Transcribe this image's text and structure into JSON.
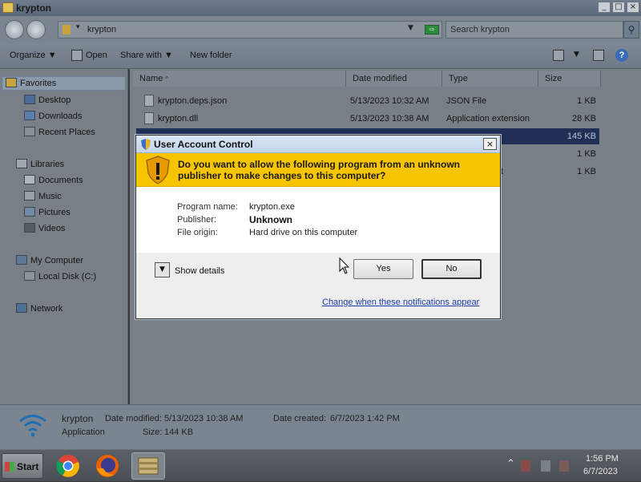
{
  "explorer": {
    "window_title": "krypton",
    "window_buttons": {
      "minimize": "_",
      "maximize": "□",
      "close": "×"
    },
    "address": {
      "path": "krypton",
      "arrow": "▾",
      "dropdown": "▼",
      "go": "⇨"
    },
    "search": {
      "placeholder": "Search krypton",
      "icon": "⚲"
    },
    "toolbar": {
      "organize": "Organize ▼",
      "open": "Open",
      "share_with": "Share with ▼",
      "new_folder": "New folder",
      "views_arrow": "▼",
      "help": "?"
    },
    "nav": {
      "favorites": "Favorites",
      "desktop": "Desktop",
      "downloads": "Downloads",
      "recent_places": "Recent Places",
      "libraries": "Libraries",
      "documents": "Documents",
      "music": "Music",
      "pictures": "Pictures",
      "videos": "Videos",
      "my_computer": "My Computer",
      "local_disk": "Local Disk (C:)",
      "network": "Network"
    },
    "columns": {
      "name": "Name",
      "sort_indicator": "^",
      "date_modified": "Date modified",
      "type": "Type",
      "size": "Size"
    },
    "files": [
      {
        "name": "krypton.deps.json",
        "date": "5/13/2023 10:32 AM",
        "type": "JSON File",
        "size": "1 KB"
      },
      {
        "name": "krypton.dll",
        "date": "5/13/2023 10:38 AM",
        "type": "Application extension",
        "size": "28 KB"
      },
      {
        "name": "",
        "date": "",
        "type": "",
        "size": "145 KB"
      },
      {
        "name": "",
        "date": "",
        "type": "",
        "size": "1 KB"
      },
      {
        "name": "",
        "date": "",
        "type": "t",
        "size": "1 KB"
      }
    ],
    "details": {
      "name": "krypton",
      "type": "Application",
      "date_modified_label": "Date modified:",
      "date_modified": "5/13/2023 10:38 AM",
      "size_label": "Size:",
      "size": "144 KB",
      "date_created_label": "Date created:",
      "date_created": "6/7/2023 1:42 PM"
    }
  },
  "uac": {
    "title": "User Account Control",
    "close": "×",
    "question": "Do you want to allow the following program from an unknown publisher to make changes to this computer?",
    "program_name_label": "Program name:",
    "program_name": "krypton.exe",
    "publisher_label": "Publisher:",
    "publisher": "Unknown",
    "file_origin_label": "File origin:",
    "file_origin": "Hard drive on this computer",
    "details_arrow": "▼",
    "show_details": "Show details",
    "yes": "Yes",
    "no": "No",
    "change_link": "Change when these notifications appear"
  },
  "taskbar": {
    "start": "Start",
    "tray_arrow": "⌃",
    "time": "1:56 PM",
    "date": "6/7/2023"
  }
}
